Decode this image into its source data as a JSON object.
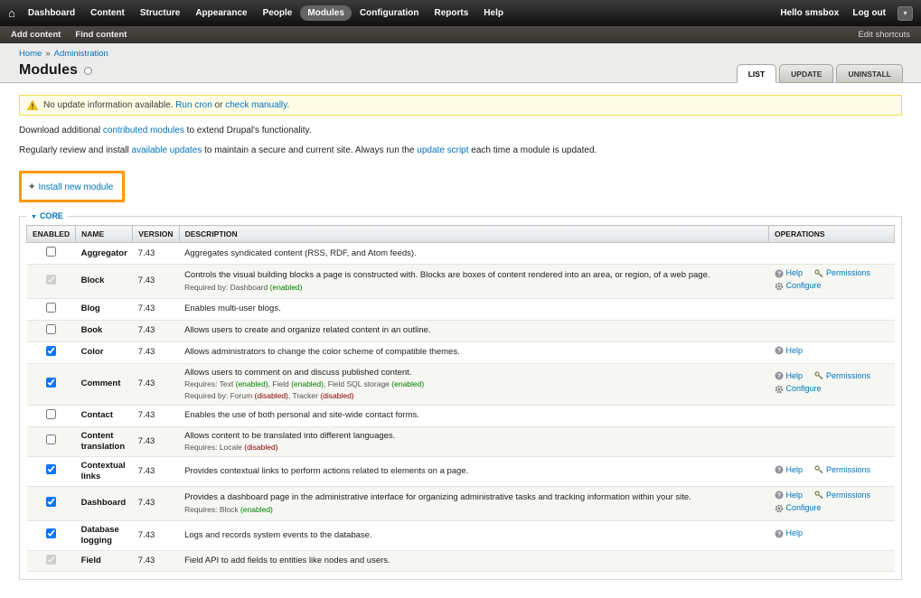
{
  "colors": {
    "link": "#0074bd",
    "status_enabled": "#008000",
    "status_disabled": "#880000",
    "highlight": "#ff9900",
    "warning_bg": "#fffce5",
    "warning_border": "#eedd55"
  },
  "toolbar": {
    "home_icon": "⌂",
    "items": [
      {
        "label": "Dashboard"
      },
      {
        "label": "Content"
      },
      {
        "label": "Structure"
      },
      {
        "label": "Appearance"
      },
      {
        "label": "People"
      },
      {
        "label": "Modules",
        "active": true
      },
      {
        "label": "Configuration"
      },
      {
        "label": "Reports"
      },
      {
        "label": "Help"
      }
    ],
    "greeting": "Hello smsbox",
    "logout_label": "Log out",
    "toggle_icon": "▾"
  },
  "shortcuts": {
    "items": [
      {
        "label": "Add content"
      },
      {
        "label": "Find content"
      }
    ],
    "edit_label": "Edit shortcuts"
  },
  "breadcrumb": {
    "separator": "»",
    "items": [
      {
        "label": "Home"
      },
      {
        "label": "Administration"
      }
    ]
  },
  "page": {
    "title": "Modules"
  },
  "tabs": [
    {
      "label": "LIST",
      "active": true
    },
    {
      "label": "UPDATE",
      "active": false
    },
    {
      "label": "UNINSTALL",
      "active": false
    }
  ],
  "message": {
    "type": "warning",
    "segments": [
      {
        "text": "No update information available. "
      },
      {
        "link": "Run cron"
      },
      {
        "text": " or "
      },
      {
        "link": "check manually"
      },
      {
        "text": "."
      }
    ]
  },
  "intro_paragraphs": [
    {
      "segments": [
        {
          "text": "Download additional "
        },
        {
          "link": "contributed modules"
        },
        {
          "text": " to extend Drupal's functionality."
        }
      ]
    },
    {
      "segments": [
        {
          "text": "Regularly review and install "
        },
        {
          "link": "available updates"
        },
        {
          "text": " to maintain a secure and current site. Always run the "
        },
        {
          "link": "update script"
        },
        {
          "text": " each time a module is updated."
        }
      ]
    }
  ],
  "install_link": {
    "plus": "+",
    "label": "Install new module"
  },
  "core_group": {
    "arrow": "▼",
    "legend": "CORE"
  },
  "module_table": {
    "headers": [
      "ENABLED",
      "NAME",
      "VERSION",
      "DESCRIPTION",
      "OPERATIONS"
    ],
    "rows": [
      {
        "name": "Aggregator",
        "version": "7.43",
        "enabled": false,
        "locked": false,
        "description": "Aggregates syndicated content (RSS, RDF, and Atom feeds).",
        "dependencies": [],
        "operations": []
      },
      {
        "name": "Block",
        "version": "7.43",
        "enabled": true,
        "locked": true,
        "description": "Controls the visual building blocks a page is constructed with. Blocks are boxes of content rendered into an area, or region, of a web page.",
        "dependencies": [
          {
            "prefix": "Required by:",
            "items": [
              {
                "name": "Dashboard",
                "status": "enabled"
              }
            ]
          }
        ],
        "operations": [
          {
            "icon": "help-icon",
            "label": "Help"
          },
          {
            "icon": "permissions-icon",
            "label": "Permissions"
          },
          {
            "icon": "configure-icon",
            "label": "Configure"
          }
        ]
      },
      {
        "name": "Blog",
        "version": "7.43",
        "enabled": false,
        "locked": false,
        "description": "Enables multi-user blogs.",
        "dependencies": [],
        "operations": []
      },
      {
        "name": "Book",
        "version": "7.43",
        "enabled": false,
        "locked": false,
        "description": "Allows users to create and organize related content in an outline.",
        "dependencies": [],
        "operations": []
      },
      {
        "name": "Color",
        "version": "7.43",
        "enabled": true,
        "locked": false,
        "description": "Allows administrators to change the color scheme of compatible themes.",
        "dependencies": [],
        "operations": [
          {
            "icon": "help-icon",
            "label": "Help"
          }
        ]
      },
      {
        "name": "Comment",
        "version": "7.43",
        "enabled": true,
        "locked": false,
        "description": "Allows users to comment on and discuss published content.",
        "dependencies": [
          {
            "prefix": "Requires:",
            "items": [
              {
                "name": "Text",
                "status": "enabled"
              },
              {
                "name": "Field",
                "status": "enabled"
              },
              {
                "name": "Field SQL storage",
                "status": "enabled"
              }
            ]
          },
          {
            "prefix": "Required by:",
            "items": [
              {
                "name": "Forum",
                "status": "disabled"
              },
              {
                "name": "Tracker",
                "status": "disabled"
              }
            ]
          }
        ],
        "operations": [
          {
            "icon": "help-icon",
            "label": "Help"
          },
          {
            "icon": "permissions-icon",
            "label": "Permissions"
          },
          {
            "icon": "configure-icon",
            "label": "Configure"
          }
        ]
      },
      {
        "name": "Contact",
        "version": "7.43",
        "enabled": false,
        "locked": false,
        "description": "Enables the use of both personal and site-wide contact forms.",
        "dependencies": [],
        "operations": []
      },
      {
        "name": "Content translation",
        "version": "7.43",
        "enabled": false,
        "locked": false,
        "description": "Allows content to be translated into different languages.",
        "dependencies": [
          {
            "prefix": "Requires:",
            "items": [
              {
                "name": "Locale",
                "status": "disabled"
              }
            ]
          }
        ],
        "operations": []
      },
      {
        "name": "Contextual links",
        "version": "7.43",
        "enabled": true,
        "locked": false,
        "description": "Provides contextual links to perform actions related to elements on a page.",
        "dependencies": [],
        "operations": [
          {
            "icon": "help-icon",
            "label": "Help"
          },
          {
            "icon": "permissions-icon",
            "label": "Permissions"
          }
        ]
      },
      {
        "name": "Dashboard",
        "version": "7.43",
        "enabled": true,
        "locked": false,
        "description": "Provides a dashboard page in the administrative interface for organizing administrative tasks and tracking information within your site.",
        "dependencies": [
          {
            "prefix": "Requires:",
            "items": [
              {
                "name": "Block",
                "status": "enabled"
              }
            ]
          }
        ],
        "operations": [
          {
            "icon": "help-icon",
            "label": "Help"
          },
          {
            "icon": "permissions-icon",
            "label": "Permissions"
          },
          {
            "icon": "configure-icon",
            "label": "Configure"
          }
        ]
      },
      {
        "name": "Database logging",
        "version": "7.43",
        "enabled": true,
        "locked": false,
        "description": "Logs and records system events to the database.",
        "dependencies": [],
        "operations": [
          {
            "icon": "help-icon",
            "label": "Help"
          }
        ]
      },
      {
        "name": "Field",
        "version": "7.43",
        "enabled": true,
        "locked": true,
        "description": "Field API to add fields to entities like nodes and users.",
        "dependencies": [],
        "operations": []
      }
    ]
  }
}
